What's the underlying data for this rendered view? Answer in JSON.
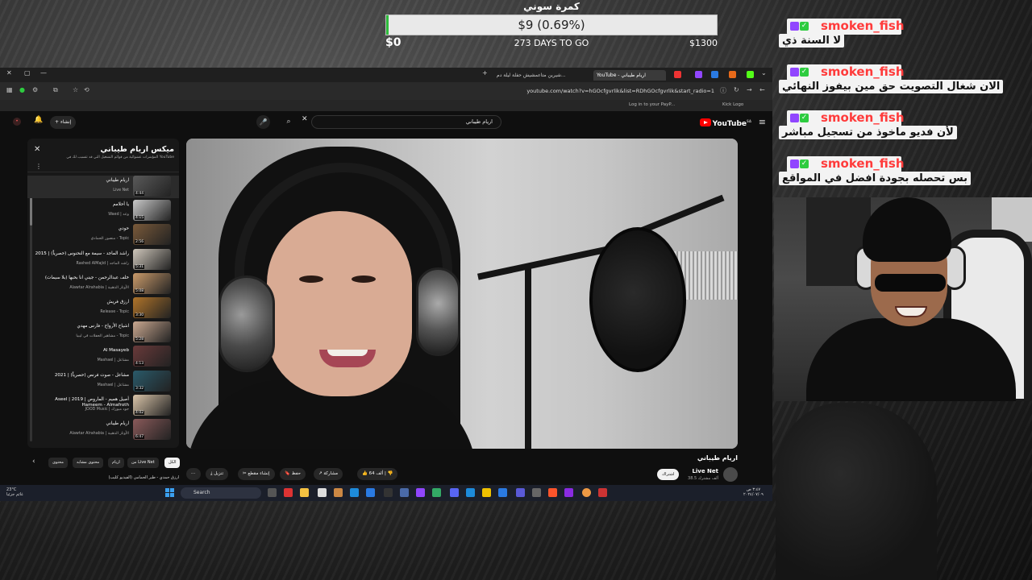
{
  "goal": {
    "title": "كمرة سوني",
    "amount": "$9 (0.69%)",
    "progress_percent": 0.69,
    "min": "$0",
    "days": "273 DAYS TO GO",
    "max": "$1300"
  },
  "browser": {
    "tabs": [
      {
        "label": "شيرين متاعمشيش حفلة ليلة دم..."
      },
      {
        "label": "YouTube - اريام طيباني",
        "active": true
      }
    ],
    "url": "youtube.com/watch?v=hGOcfgvrlik&list=RDhGOcfgvrlik&start_radio=1",
    "bookmarks": [
      "Log in to your PayP...",
      "Kick Logo"
    ],
    "window_controls": {
      "minimize": "—",
      "restore": "▢",
      "close": "✕"
    }
  },
  "youtube": {
    "logo": "YouTube",
    "logo_region": "SA",
    "search_value": "اريام طيباني",
    "create_label": "إنشاء",
    "playlist": {
      "title": "ميكس اريام طيباني",
      "subtitle": "المؤشرات عشوائية من قوائم التشغيل التي قد تتسبب لك في YouTube",
      "items": [
        {
          "name": "اريام طيباني",
          "artist": "Live Net",
          "duration": "4:44",
          "active": true,
          "color": "#5a5a5a"
        },
        {
          "name": "يا أحلامم",
          "artist": "Waed | وعد",
          "duration": "4:15",
          "color": "#c9c9c9"
        },
        {
          "name": "حودي",
          "artist": "منصور الحمادي - Topic",
          "duration": "2:56",
          "color": "#7a5a3a"
        },
        {
          "name": "راشد الماجد - سيمة مع النحنوس (حصرياً) | 2015",
          "artist": "Rashed AlMajid | راشد الماجد",
          "duration": "5:31",
          "color": "#cfc7bb"
        },
        {
          "name": "خلف عبدالرحمن - جيني انا بحبها (بلا سيمات)",
          "artist": "Alawtar Alrahabia | الأوتار الذهبية",
          "duration": "5:08",
          "color": "#c99a6a"
        },
        {
          "name": "ارزق فريش",
          "artist": "Release - Topic",
          "duration": "3:30",
          "color": "#b0742a"
        },
        {
          "name": "اشياح الأرواح - فارس مهدي",
          "artist": "مشاهير الحفلات في ليبيا - Topic",
          "duration": "5:28",
          "color": "#caa890"
        },
        {
          "name": "Al Masayeb",
          "artist": "Mashael | مشاعل",
          "duration": "4:13",
          "color": "#6a3a3a"
        },
        {
          "name": "مشاعل - صوت فرنص (حصرياً) | 2021",
          "artist": "Mashael | مشاعل",
          "duration": "3:32",
          "color": "#2a5a6a"
        },
        {
          "name": "Aseel | 2019 | أصيل هميم - الماروص Hameem - Almafroth",
          "artist": "JOOD Music | جود ميوزك",
          "duration": "4:02",
          "color": "#d9c4a8"
        },
        {
          "name": "اريام طيباني",
          "artist": "Alawtar Alrahabia | الأوتار الذهبية",
          "duration": "6:47",
          "color": "#8a5a5a"
        }
      ]
    },
    "video": {
      "title": "اريام طيباني",
      "channel": "Live Net",
      "subscribers": "38.5 ألف مشترك",
      "subscribe_label": "اشتراك",
      "like_count": "64 ألف",
      "actions": {
        "share": "مشاركة",
        "save": "حفظ",
        "clip": "إنشاء مقطع",
        "download": "تنزيل",
        "more": "⋯"
      }
    },
    "chips": [
      "الكل",
      "من Live Net",
      "اريام",
      "محتوى مشابه",
      "محتوى"
    ],
    "next_item": "ارزق حمدي - طير الحمامي (الفيديو كليب)"
  },
  "taskbar": {
    "weather_temp": "23°C",
    "weather_desc": "غائم جزئيا",
    "search_placeholder": "Search",
    "time": "٣:٤٧ ص",
    "date": "٢٠٢٤/٠٧/٠٩"
  },
  "chat": {
    "messages": [
      {
        "user": "smoken_fish",
        "text": "لا السنة ذي"
      },
      {
        "user": "smoken_fish",
        "text": "الان شغال التصويت حق مين بيفوز النهائي"
      },
      {
        "user": "smoken_fish",
        "text": "لأن فديو ماخوذ من تسجيل مباشر"
      },
      {
        "user": "smoken_fish",
        "text": "بس تحصله بجودة افضل في المواقع"
      }
    ],
    "name_color": "#ff3b3b"
  }
}
